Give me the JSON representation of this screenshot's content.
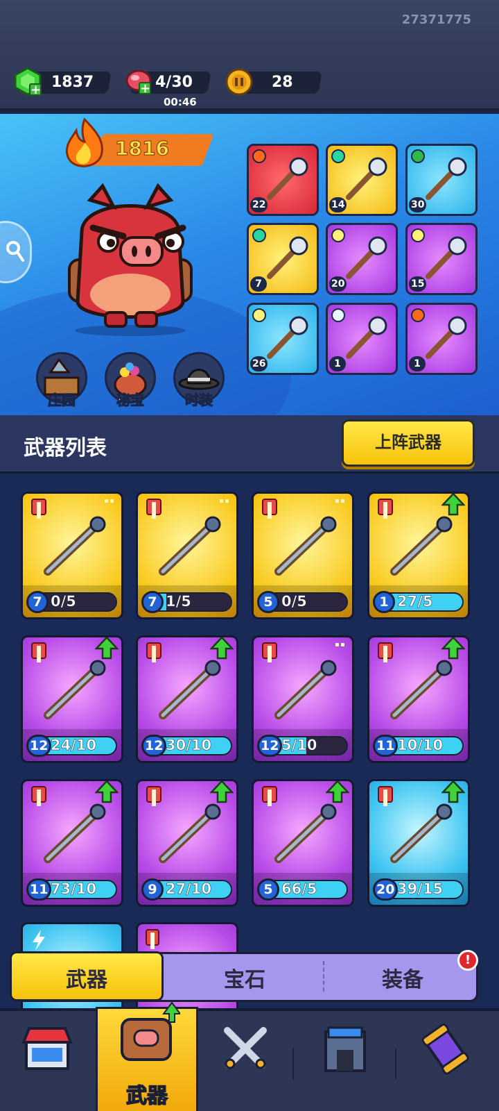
{
  "user_id": "27371775",
  "resources": {
    "gems": "1837",
    "energy": "4/30",
    "energy_timer": "00:46",
    "coins": "28"
  },
  "hero": {
    "power": "1816",
    "buttons": [
      {
        "label": "庄园",
        "icon": "manor-icon"
      },
      {
        "label": "秘宝",
        "icon": "treasure-icon"
      },
      {
        "label": "时装",
        "icon": "costume-hat-icon"
      }
    ],
    "equipped": [
      {
        "level": "22",
        "rarity": "red",
        "element": "fire"
      },
      {
        "level": "14",
        "rarity": "yellow",
        "element": "wind"
      },
      {
        "level": "30",
        "rarity": "blue",
        "element": "poison"
      },
      {
        "level": "7",
        "rarity": "yellow",
        "element": "wind"
      },
      {
        "level": "20",
        "rarity": "purple",
        "element": "light"
      },
      {
        "level": "15",
        "rarity": "purple",
        "element": "light"
      },
      {
        "level": "26",
        "rarity": "blue",
        "element": "light"
      },
      {
        "level": "1",
        "rarity": "purple",
        "element": "ice"
      },
      {
        "level": "1",
        "rarity": "purple",
        "element": "fire"
      }
    ]
  },
  "weapon_list": {
    "title": "武器列表",
    "deploy_button": "上阵武器",
    "weapons": [
      {
        "name": "poison-dagger",
        "level": "7",
        "progress": "0/5",
        "fill": 0.0,
        "rarity": "yellow"
      },
      {
        "name": "ice-crystal",
        "level": "7",
        "progress": "1/5",
        "fill": 0.2,
        "rarity": "yellow"
      },
      {
        "name": "pistol",
        "level": "5",
        "progress": "0/5",
        "fill": 0.0,
        "rarity": "yellow"
      },
      {
        "name": "horn-hook",
        "level": "1",
        "progress": "27/5",
        "fill": 1.0,
        "rarity": "yellow"
      },
      {
        "name": "crossbow",
        "level": "12",
        "progress": "24/10",
        "fill": 1.0,
        "rarity": "purple"
      },
      {
        "name": "flintlock",
        "level": "12",
        "progress": "30/10",
        "fill": 1.0,
        "rarity": "purple"
      },
      {
        "name": "shuriken",
        "level": "12",
        "progress": "5/10",
        "fill": 0.5,
        "rarity": "purple"
      },
      {
        "name": "spiked-spear",
        "level": "11",
        "progress": "10/10",
        "fill": 1.0,
        "rarity": "purple"
      },
      {
        "name": "longbow",
        "level": "11",
        "progress": "73/10",
        "fill": 1.0,
        "rarity": "purple"
      },
      {
        "name": "flail",
        "level": "9",
        "progress": "27/10",
        "fill": 1.0,
        "rarity": "purple"
      },
      {
        "name": "boomerang",
        "level": "5",
        "progress": "66/5",
        "fill": 1.0,
        "rarity": "purple"
      },
      {
        "name": "sword",
        "level": "20",
        "progress": "39/15",
        "fill": 1.0,
        "rarity": "blue"
      }
    ]
  },
  "sub_tabs": [
    "武器",
    "宝石",
    "装备"
  ],
  "sub_tab_alert": "!",
  "bottom_nav": {
    "active_label": "武器",
    "items": [
      "shop-icon",
      "weapon-bag-icon",
      "battle-swords-icon",
      "castle-icon",
      "capsule-icon"
    ]
  }
}
